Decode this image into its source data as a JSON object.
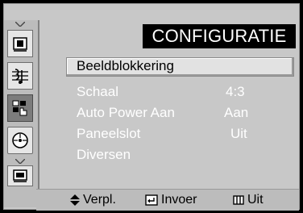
{
  "header": {
    "title": "CONFIGURATIE"
  },
  "sidebar": {
    "items": [
      {
        "icon": "picture-icon"
      },
      {
        "icon": "sound-icon"
      },
      {
        "icon": "setup-icon",
        "active": true
      },
      {
        "icon": "input-icon"
      },
      {
        "icon": "channel-icon"
      }
    ]
  },
  "menu": {
    "items": [
      {
        "label": "Beeldblokkering",
        "value": ""
      },
      {
        "label": "Schaal",
        "value": "4:3"
      },
      {
        "label": "Auto Power Aan",
        "value": "Aan"
      },
      {
        "label": "Paneelslot",
        "value": "Uit"
      },
      {
        "label": "Diversen",
        "value": ""
      }
    ]
  },
  "footer": {
    "move": "Verpl.",
    "enter": "Invoer",
    "exit": "Uit"
  }
}
